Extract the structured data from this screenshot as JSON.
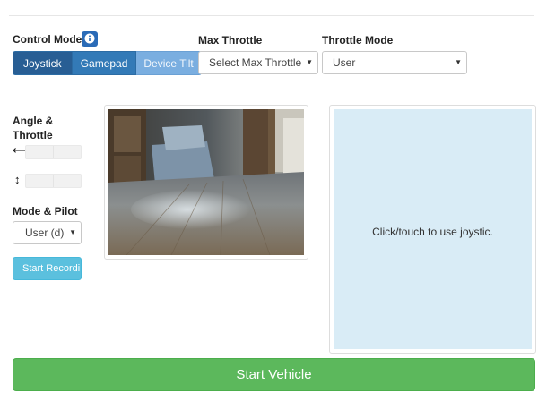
{
  "controls": {
    "control_mode_label": "Control Mode",
    "info_icon": "info-icon",
    "modes": [
      "Joystick",
      "Gamepad",
      "Device Tilt"
    ],
    "active_mode": "Joystick",
    "max_throttle_label": "Max Throttle",
    "max_throttle_value": "Select Max Throttle",
    "throttle_mode_label": "Throttle Mode",
    "throttle_mode_value": "User"
  },
  "sidebar": {
    "angle_throttle_label_line1": "Angle &",
    "angle_throttle_label_line2": "Throttle",
    "angle_icon": "left-right-arrow-icon",
    "throttle_icon": "up-down-arrow-icon",
    "mode_pilot_label": "Mode & Pilot",
    "mode_pilot_value": "User (d)",
    "record_button": "Start Recording"
  },
  "camera": {
    "feed_icon": "camera-feed-image"
  },
  "joystick": {
    "hint": "Click/touch to use joystic."
  },
  "start_button": "Start Vehicle",
  "colors": {
    "primary": "#337ab7",
    "primary_active": "#285e94",
    "primary_light": "#7aaee0",
    "info": "#5bc0de",
    "success": "#5cb85c",
    "joystick_bg": "#d9ecf6"
  }
}
